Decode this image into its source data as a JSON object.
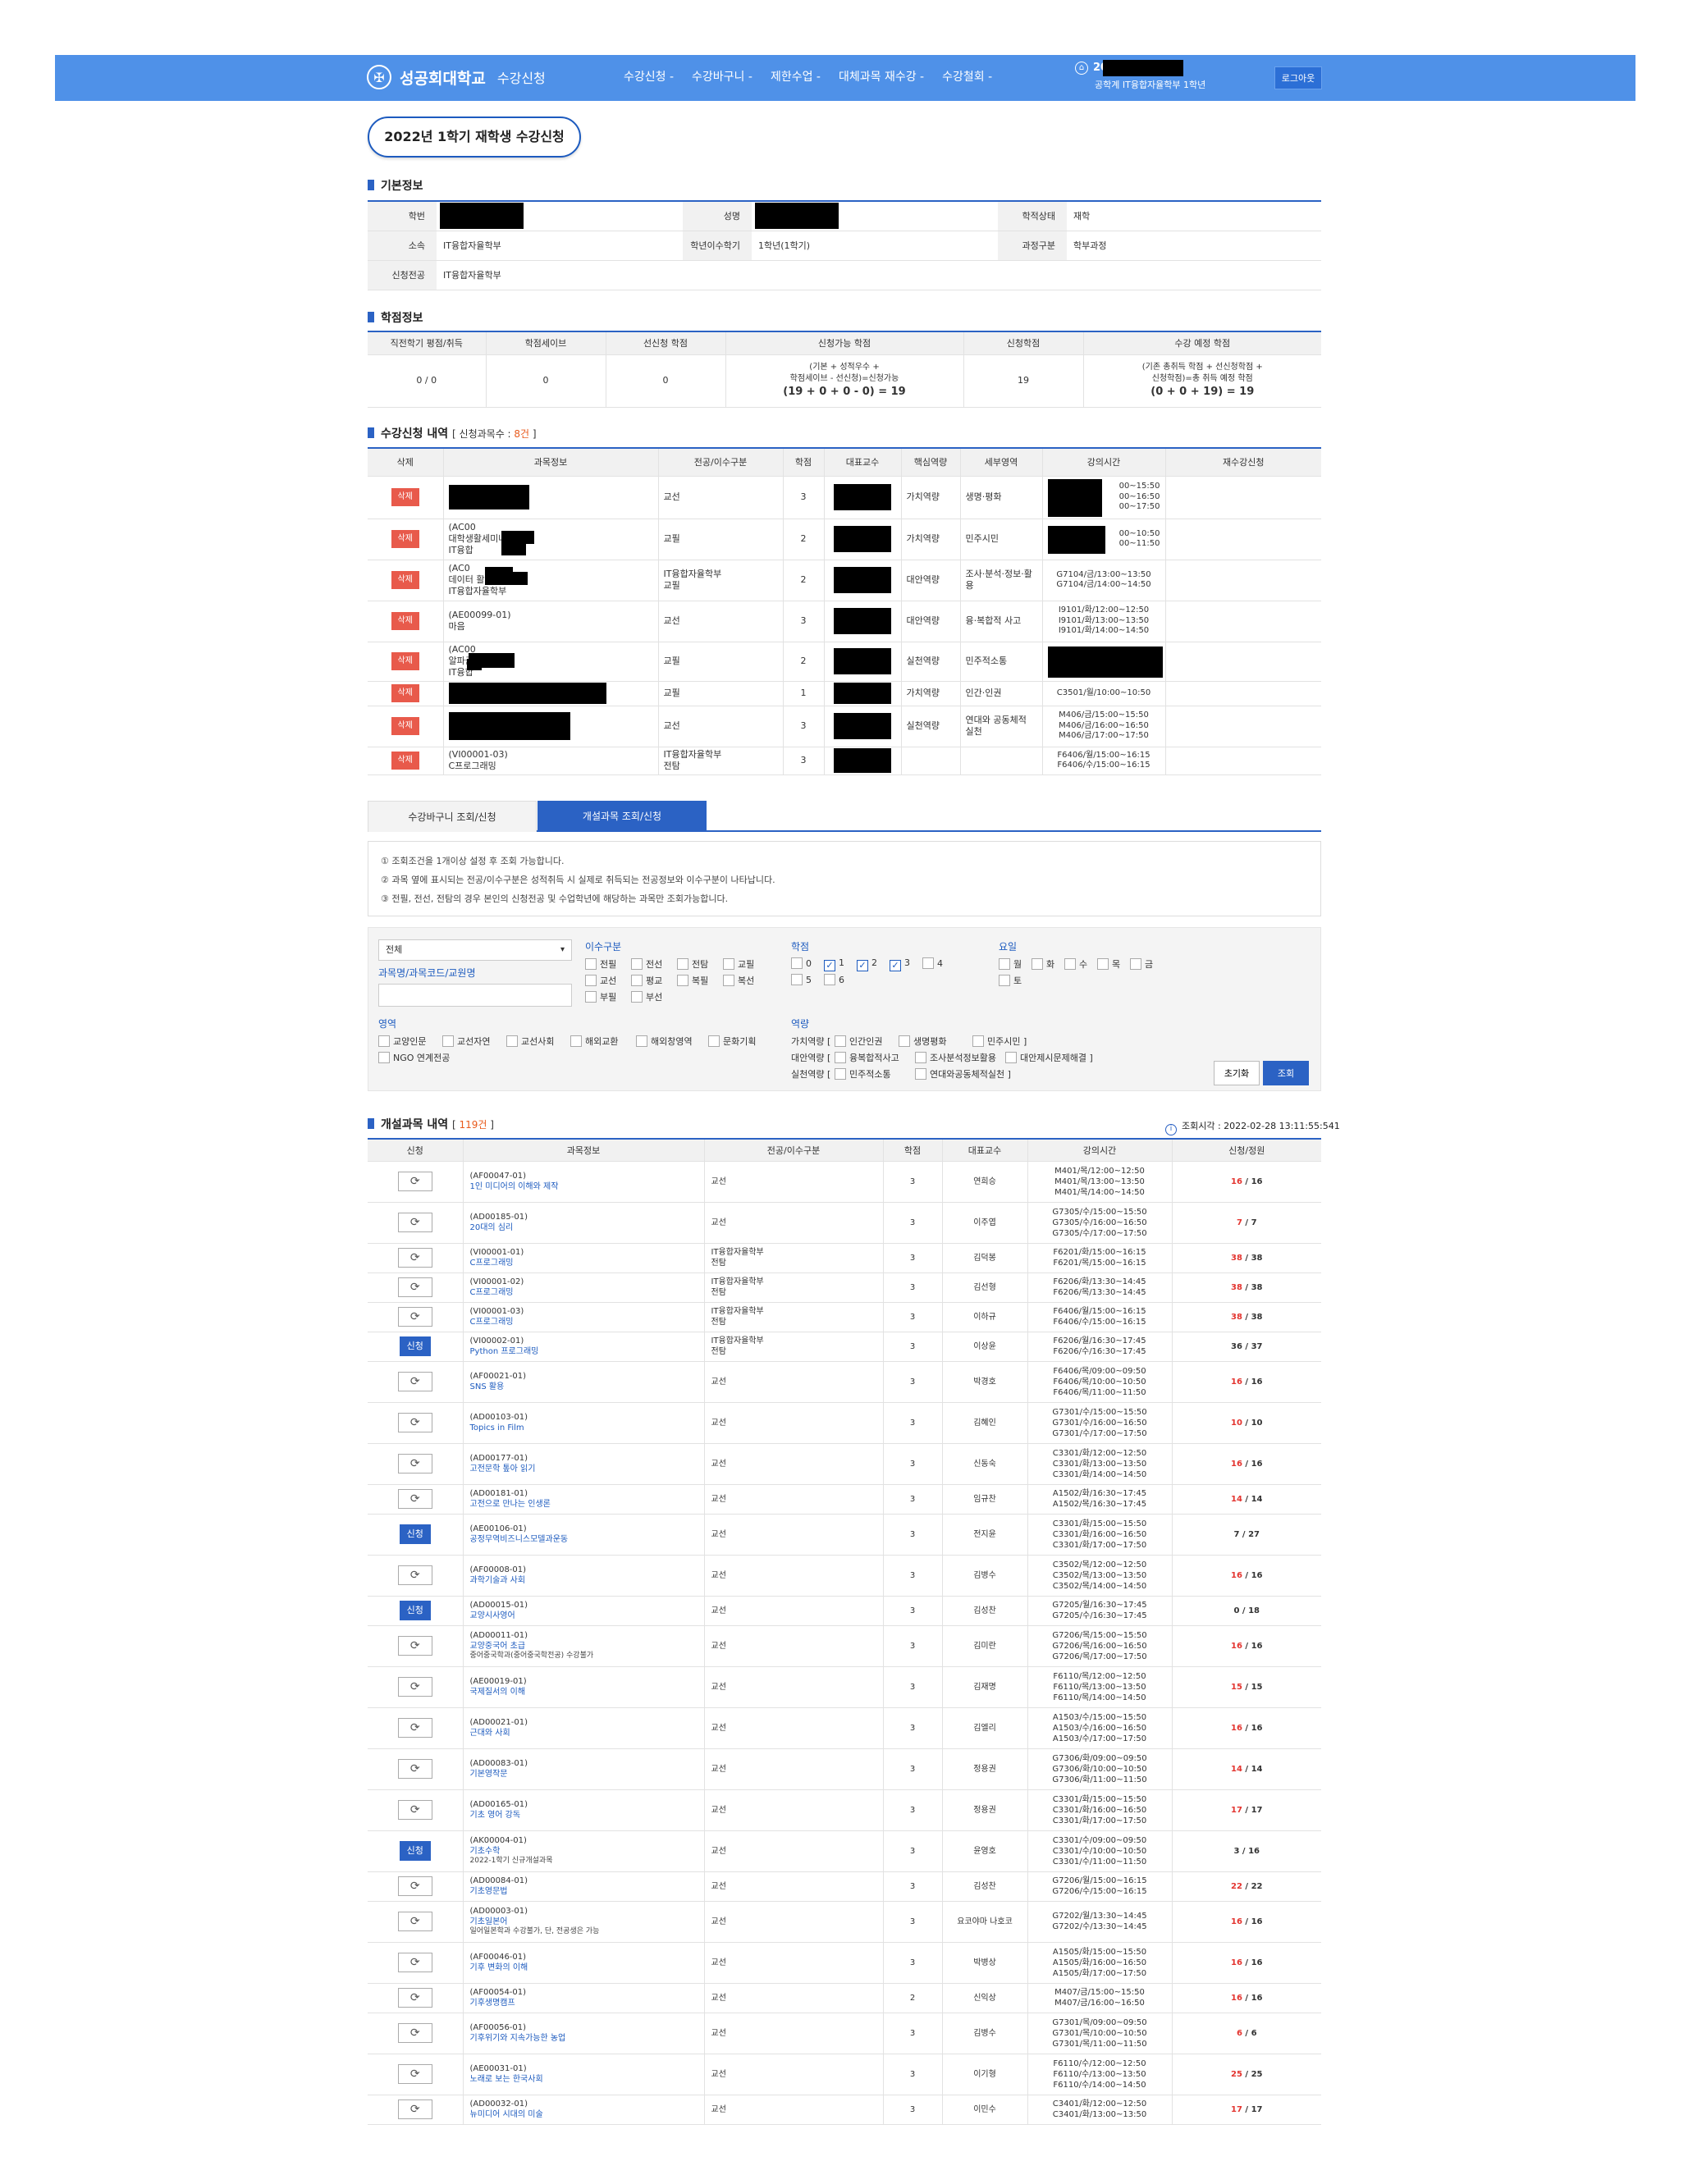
{
  "header": {
    "logo_text": "성공회대학교",
    "app_name": "수강신청",
    "menu": [
      "수강신청 -",
      "수강바구니 -",
      "제한수업 -",
      "대체과목 재수강 -",
      "수강철회 -"
    ],
    "user_id_prefix": "20",
    "user_dept": "공학계 IT융합자율학부 1학년",
    "logout": "로그아웃"
  },
  "page_title": "2022년 1학기 재학생 수강신청",
  "basic": {
    "title": "기본정보",
    "labels": {
      "student_no": "학번",
      "name": "성명",
      "status": "학적상태",
      "affil": "소속",
      "year": "학년이수학기",
      "course_type": "과정구분",
      "major": "신청전공"
    },
    "values": {
      "status": "재학",
      "affil": "IT융합자율학부",
      "year": "1학년(1학기)",
      "course_type": "학부과정",
      "major": "IT융합자율학부"
    }
  },
  "credit": {
    "title": "학점정보",
    "headers": [
      "직전학기 평점/취득",
      "학점세이브",
      "선신청 학점",
      "신청가능 학점",
      "신청학점",
      "수강 예정 학점"
    ],
    "c0": "0 / 0",
    "c1": "0",
    "c2": "0",
    "c3a": "(기본 + 성적우수 +",
    "c3b": "학점세이브 - 선신청)=신청가능",
    "c3c": "(19 + 0 + 0 - 0) = 19",
    "c4": "19",
    "c5a": "(기존 총취득 학점 + 선신청학점 +",
    "c5b": "신청학점)=총 취득 예정 학점",
    "c5c": "(0 + 0 + 19) = 19"
  },
  "reg": {
    "title": "수강신청 내역",
    "count_pre": "[ 신청과목수 : ",
    "count": "8건",
    "count_post": " ]",
    "headers": [
      "삭제",
      "과목정보",
      "전공/이수구분",
      "학점",
      "대표교수",
      "핵심역량",
      "세부영역",
      "강의시간",
      "재수강신청"
    ],
    "delete_label": "삭제",
    "rows": [
      {
        "info": [
          "",
          "",
          ""
        ],
        "type": "교선",
        "credit": "3",
        "comp": "가치역량",
        "area": "생명·평화",
        "time": [
          "00~15:50",
          "00~16:50",
          "00~17:50"
        ]
      },
      {
        "info": [
          "(AC00",
          "대학생활세미나 I",
          "IT융합"
        ],
        "type": "교필",
        "credit": "2",
        "comp": "가치역량",
        "area": "민주시민",
        "time": [
          "00~10:50",
          "00~11:50"
        ]
      },
      {
        "info": [
          "(AC0",
          "데이터 활용 및 분석",
          "IT융합자율학부"
        ],
        "type": "IT융합자율학부\n교필",
        "credit": "2",
        "comp": "대안역량",
        "area": "조사·분석·정보·활용",
        "time": [
          "G7104/금/13:00~13:50",
          "G7104/금/14:00~14:50"
        ]
      },
      {
        "info": [
          "(AE00099-01)",
          "마음"
        ],
        "type": "교선",
        "credit": "3",
        "comp": "대안역량",
        "area": "융·복합적 사고",
        "time": [
          "I9101/화/12:00~12:50",
          "I9101/화/13:00~13:50",
          "I9101/화/14:00~14:50"
        ]
      },
      {
        "info": [
          "(AC00",
          "알파금",
          "IT융합"
        ],
        "type": "교필",
        "credit": "2",
        "comp": "실천역량",
        "area": "민주적소통",
        "time": []
      },
      {
        "info": [
          ""
        ],
        "type": "교필",
        "credit": "1",
        "comp": "가치역량",
        "area": "인간·인권",
        "time": [
          "C3501/월/10:00~10:50"
        ]
      },
      {
        "info": [
          ""
        ],
        "type": "교선",
        "credit": "3",
        "comp": "실천역량",
        "area": "연대와 공동체적 실천",
        "time": [
          "M406/금/15:00~15:50",
          "M406/금/16:00~16:50",
          "M406/금/17:00~17:50"
        ]
      },
      {
        "info": [
          "(VI00001-03)",
          "C프로그래밍"
        ],
        "type": "IT융합자율학부\n전탐",
        "credit": "3",
        "comp": "",
        "area": "",
        "time": [
          "F6406/월/15:00~16:15",
          "F6406/수/15:00~16:15"
        ]
      }
    ]
  },
  "tabs": [
    "수강바구니 조회/신청",
    "개설과목 조회/신청"
  ],
  "notices": [
    "① 조회조건을 1개이상 설정 후 조회 가능합니다.",
    "② 과목 옆에 표시되는 전공/이수구분은 성적취득 시 실제로 취득되는 전공정보와 이수구분이 나타납니다.",
    "③ 전필, 전선, 전탐의 경우 본인의 신청전공 및 수업학년에 해당하는 과목만 조회가능합니다."
  ],
  "filter": {
    "select": "전체",
    "search_label": "과목명/과목코드/교원명",
    "type_label": "이수구분",
    "types": [
      "전필",
      "전선",
      "전탐",
      "교필",
      "교선",
      "평교",
      "복필",
      "복선",
      "부필",
      "부선"
    ],
    "year_label": "학점",
    "years": [
      "0",
      "1",
      "2",
      "3",
      "4",
      "5",
      "6"
    ],
    "day_label": "요일",
    "days": [
      "월",
      "화",
      "수",
      "목",
      "금",
      "토"
    ],
    "area_label": "영역",
    "areas": [
      "교양인문",
      "교선자연",
      "교선사회",
      "해외교환",
      "해외창영역",
      "문화기획",
      "NGO 연계전공"
    ],
    "comp_label": "역량",
    "comp_rows": [
      {
        "label": "가치역량 [",
        "items": [
          "인간인권",
          "생명평화",
          "민주시민 ]"
        ]
      },
      {
        "label": "대안역량 [",
        "items": [
          "융복합적사고",
          "조사분석정보활용",
          "대안제시문제해결 ]"
        ]
      },
      {
        "label": "실천역량 [",
        "items": [
          "민주적소통",
          "연대와공동체적실천 ]"
        ]
      }
    ],
    "reset": "초기화",
    "search": "조회"
  },
  "opened": {
    "title": "개설과목 내역",
    "count_pre": "[ ",
    "count": "119건",
    "count_post": " ]",
    "query_time": "조회시각 : 2022-02-28 13:11:55:541",
    "headers": [
      "신청",
      "과목정보",
      "전공/이수구분",
      "학점",
      "대표교수",
      "강의시간",
      "신청/정원"
    ],
    "apply_label": "신청",
    "rows": [
      {
        "code": "(AF00047-01)",
        "title": "1인 미디어의 이해와 제작",
        "note": "",
        "type": "교선",
        "credit": "3",
        "prof": "연희승",
        "time": [
          "M401/목/12:00~12:50",
          "M401/목/13:00~13:50",
          "M401/목/14:00~14:50"
        ],
        "enrolled": "16",
        "cap": "16",
        "apply": false
      },
      {
        "code": "(AD00185-01)",
        "title": "20대의 심리",
        "note": "",
        "type": "교선",
        "credit": "3",
        "prof": "이주엽",
        "time": [
          "G7305/수/15:00~15:50",
          "G7305/수/16:00~16:50",
          "G7305/수/17:00~17:50"
        ],
        "enrolled": "7",
        "cap": "7",
        "apply": false
      },
      {
        "code": "(VI00001-01)",
        "title": "C프로그래밍",
        "note": "",
        "type": "IT융합자율학부\n전탐",
        "credit": "3",
        "prof": "김덕봉",
        "time": [
          "F6201/화/15:00~16:15",
          "F6201/목/15:00~16:15"
        ],
        "enrolled": "38",
        "cap": "38",
        "apply": false
      },
      {
        "code": "(VI00001-02)",
        "title": "C프로그래밍",
        "note": "",
        "type": "IT융합자율학부\n전탐",
        "credit": "3",
        "prof": "김선형",
        "time": [
          "F6206/화/13:30~14:45",
          "F6206/목/13:30~14:45"
        ],
        "enrolled": "38",
        "cap": "38",
        "apply": false
      },
      {
        "code": "(VI00001-03)",
        "title": "C프로그래밍",
        "note": "",
        "type": "IT융합자율학부\n전탐",
        "credit": "3",
        "prof": "이하규",
        "time": [
          "F6406/월/15:00~16:15",
          "F6406/수/15:00~16:15"
        ],
        "enrolled": "38",
        "cap": "38",
        "apply": false
      },
      {
        "code": "(VI00002-01)",
        "title": "Python 프로그래밍",
        "note": "",
        "type": "IT융합자율학부\n전탐",
        "credit": "3",
        "prof": "이상윤",
        "time": [
          "F6206/월/16:30~17:45",
          "F6206/수/16:30~17:45"
        ],
        "enrolled": "36",
        "cap": "37",
        "apply": true
      },
      {
        "code": "(AF00021-01)",
        "title": "SNS 활용",
        "note": "",
        "type": "교선",
        "credit": "3",
        "prof": "박경호",
        "time": [
          "F6406/목/09:00~09:50",
          "F6406/목/10:00~10:50",
          "F6406/목/11:00~11:50"
        ],
        "enrolled": "16",
        "cap": "16",
        "apply": false
      },
      {
        "code": "(AD00103-01)",
        "title": "Topics in Film",
        "note": "",
        "type": "교선",
        "credit": "3",
        "prof": "김혜인",
        "time": [
          "G7301/수/15:00~15:50",
          "G7301/수/16:00~16:50",
          "G7301/수/17:00~17:50"
        ],
        "enrolled": "10",
        "cap": "10",
        "apply": false
      },
      {
        "code": "(AD00177-01)",
        "title": "고전문학 톺아 읽기",
        "note": "",
        "type": "교선",
        "credit": "3",
        "prof": "신동숙",
        "time": [
          "C3301/화/12:00~12:50",
          "C3301/화/13:00~13:50",
          "C3301/화/14:00~14:50"
        ],
        "enrolled": "16",
        "cap": "16",
        "apply": false
      },
      {
        "code": "(AD00181-01)",
        "title": "고전으로 만나는 인생론",
        "note": "",
        "type": "교선",
        "credit": "3",
        "prof": "임규찬",
        "time": [
          "A1502/화/16:30~17:45",
          "A1502/목/16:30~17:45"
        ],
        "enrolled": "14",
        "cap": "14",
        "apply": false
      },
      {
        "code": "(AE00106-01)",
        "title": "공정무역비즈니스모델과운동",
        "note": "",
        "type": "교선",
        "credit": "3",
        "prof": "전지윤",
        "time": [
          "C3301/화/15:00~15:50",
          "C3301/화/16:00~16:50",
          "C3301/화/17:00~17:50"
        ],
        "enrolled": "7",
        "cap": "27",
        "apply": true
      },
      {
        "code": "(AF00008-01)",
        "title": "과학기술과 사회",
        "note": "",
        "type": "교선",
        "credit": "3",
        "prof": "김병수",
        "time": [
          "C3502/목/12:00~12:50",
          "C3502/목/13:00~13:50",
          "C3502/목/14:00~14:50"
        ],
        "enrolled": "16",
        "cap": "16",
        "apply": false
      },
      {
        "code": "(AD00015-01)",
        "title": "교양시사영어",
        "note": "",
        "type": "교선",
        "credit": "3",
        "prof": "김성찬",
        "time": [
          "G7205/월/16:30~17:45",
          "G7205/수/16:30~17:45"
        ],
        "enrolled": "0",
        "cap": "18",
        "apply": true
      },
      {
        "code": "(AD00011-01)",
        "title": "교양중국어 초급",
        "note": "중어중국학과(중어중국학전공) 수강불가",
        "type": "교선",
        "credit": "3",
        "prof": "김미란",
        "time": [
          "G7206/목/15:00~15:50",
          "G7206/목/16:00~16:50",
          "G7206/목/17:00~17:50"
        ],
        "enrolled": "16",
        "cap": "16",
        "apply": false
      },
      {
        "code": "(AE00019-01)",
        "title": "국제질서의 이해",
        "note": "",
        "type": "교선",
        "credit": "3",
        "prof": "김재명",
        "time": [
          "F6110/목/12:00~12:50",
          "F6110/목/13:00~13:50",
          "F6110/목/14:00~14:50"
        ],
        "enrolled": "15",
        "cap": "15",
        "apply": false
      },
      {
        "code": "(AD00021-01)",
        "title": "근대와 사회",
        "note": "",
        "type": "교선",
        "credit": "3",
        "prof": "김엘리",
        "time": [
          "A1503/수/15:00~15:50",
          "A1503/수/16:00~16:50",
          "A1503/수/17:00~17:50"
        ],
        "enrolled": "16",
        "cap": "16",
        "apply": false
      },
      {
        "code": "(AD00083-01)",
        "title": "기본영작문",
        "note": "",
        "type": "교선",
        "credit": "3",
        "prof": "정용권",
        "time": [
          "G7306/화/09:00~09:50",
          "G7306/화/10:00~10:50",
          "G7306/화/11:00~11:50"
        ],
        "enrolled": "14",
        "cap": "14",
        "apply": false
      },
      {
        "code": "(AD00165-01)",
        "title": "기초 영어 강독",
        "note": "",
        "type": "교선",
        "credit": "3",
        "prof": "정용권",
        "time": [
          "C3301/화/15:00~15:50",
          "C3301/화/16:00~16:50",
          "C3301/화/17:00~17:50"
        ],
        "enrolled": "17",
        "cap": "17",
        "apply": false
      },
      {
        "code": "(AK00004-01)",
        "title": "기초수학",
        "note": "2022-1학기 신규개설과목",
        "type": "교선",
        "credit": "3",
        "prof": "윤영호",
        "time": [
          "C3301/수/09:00~09:50",
          "C3301/수/10:00~10:50",
          "C3301/수/11:00~11:50"
        ],
        "enrolled": "3",
        "cap": "16",
        "apply": true
      },
      {
        "code": "(AD00084-01)",
        "title": "기초영문법",
        "note": "",
        "type": "교선",
        "credit": "3",
        "prof": "김성찬",
        "time": [
          "G7206/월/15:00~16:15",
          "G7206/수/15:00~16:15"
        ],
        "enrolled": "22",
        "cap": "22",
        "apply": false
      },
      {
        "code": "(AD00003-01)",
        "title": "기초일본어",
        "note": "일어일본학과 수강불가, 단, 전공생은 가능",
        "type": "교선",
        "credit": "3",
        "prof": "요코야마 나호코",
        "time": [
          "G7202/월/13:30~14:45",
          "G7202/수/13:30~14:45"
        ],
        "enrolled": "16",
        "cap": "16",
        "apply": false
      },
      {
        "code": "(AF00046-01)",
        "title": "기후 변화의 이해",
        "note": "",
        "type": "교선",
        "credit": "3",
        "prof": "박병상",
        "time": [
          "A1505/화/15:00~15:50",
          "A1505/화/16:00~16:50",
          "A1505/화/17:00~17:50"
        ],
        "enrolled": "16",
        "cap": "16",
        "apply": false
      },
      {
        "code": "(AF00054-01)",
        "title": "기후생명캠프",
        "note": "",
        "type": "교선",
        "credit": "2",
        "prof": "신익상",
        "time": [
          "M407/금/15:00~15:50",
          "M407/금/16:00~16:50"
        ],
        "enrolled": "16",
        "cap": "16",
        "apply": false
      },
      {
        "code": "(AF00056-01)",
        "title": "기후위기와 지속가능한 농업",
        "note": "",
        "type": "교선",
        "credit": "3",
        "prof": "김병수",
        "time": [
          "G7301/목/09:00~09:50",
          "G7301/목/10:00~10:50",
          "G7301/목/11:00~11:50"
        ],
        "enrolled": "6",
        "cap": "6",
        "apply": false
      },
      {
        "code": "(AE00031-01)",
        "title": "노래로 보는 한국사회",
        "note": "",
        "type": "교선",
        "credit": "3",
        "prof": "이기형",
        "time": [
          "F6110/수/12:00~12:50",
          "F6110/수/13:00~13:50",
          "F6110/수/14:00~14:50"
        ],
        "enrolled": "25",
        "cap": "25",
        "apply": false
      },
      {
        "code": "(AD00032-01)",
        "title": "뉴미디어 시대의 미술",
        "note": "",
        "type": "교선",
        "credit": "3",
        "prof": "이민수",
        "time": [
          "C3401/화/12:00~12:50",
          "C3401/화/13:00~13:50"
        ],
        "enrolled": "17",
        "cap": "17",
        "apply": false
      }
    ]
  }
}
